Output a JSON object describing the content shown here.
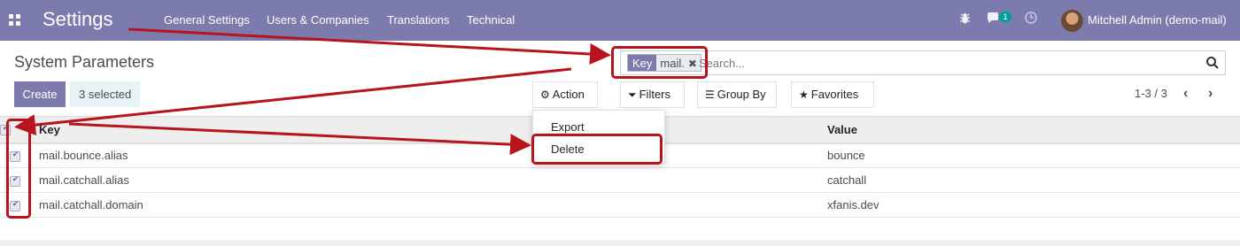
{
  "navbar": {
    "app_title": "Settings",
    "menu": [
      "General Settings",
      "Users & Companies",
      "Translations",
      "Technical"
    ],
    "chat_badge": "1",
    "user_name": "Mitchell Admin (demo-mail)",
    "bg_color": "#7c7bad"
  },
  "control_panel": {
    "breadcrumb": "System Parameters",
    "search": {
      "facet_key": "Key",
      "facet_value": "mail.",
      "placeholder": "Search..."
    },
    "create_label": "Create",
    "selected_label": "3 selected",
    "buttons": {
      "action": "Action",
      "filters": "Filters",
      "group_by": "Group By",
      "favorites": "Favorites"
    },
    "pager": "1-3 / 3"
  },
  "action_menu": {
    "export": "Export",
    "delete": "Delete"
  },
  "table": {
    "headers": {
      "key": "Key",
      "value": "Value"
    },
    "rows": [
      {
        "key": "mail.bounce.alias",
        "value": "bounce"
      },
      {
        "key": "mail.catchall.alias",
        "value": "catchall"
      },
      {
        "key": "mail.catchall.domain",
        "value": "xfanis.dev"
      }
    ]
  },
  "annotation_color": "#b8141e"
}
